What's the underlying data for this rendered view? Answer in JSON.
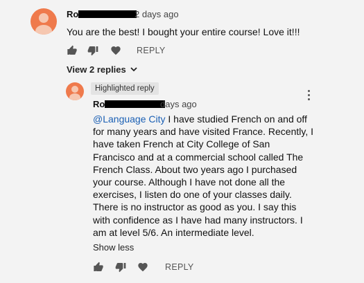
{
  "comment": {
    "author_visible": "Ro",
    "time": "2 days ago",
    "text": "You are the best! I bought your entire course! Love it!!!",
    "reply_label": "REPLY"
  },
  "replies_toggle": {
    "label": "View 2 replies"
  },
  "reply": {
    "badge": "Highlighted reply",
    "author_visible": "Ro",
    "time": "days ago",
    "mention": "@Language City",
    "lines": [
      " I have studied French on and off",
      "for many years and have visited France. Recently, I",
      "have taken French at City College of San",
      "Francisco and at a commercial school called The",
      "French Class. About two years ago I purchased",
      "your course. Although I have not done all the",
      "exercises, I listen do one of your classes daily.",
      "There is no instructor as good as you. I say this",
      "with confidence as I have had many instructors. I",
      "am at level 5/6. An intermediate level."
    ],
    "show_less": "Show less",
    "reply_label": "REPLY"
  },
  "icons": [
    "like-icon",
    "dislike-icon",
    "heart-icon",
    "chevron-down-icon",
    "more-vert-icon",
    "avatar"
  ]
}
